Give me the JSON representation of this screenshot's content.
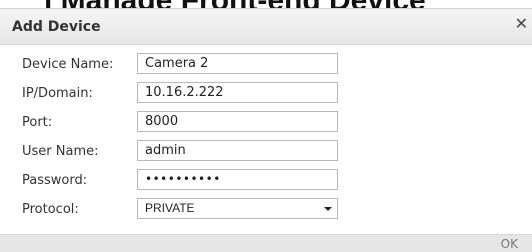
{
  "page": {
    "heading": "i Manage Front-end Device"
  },
  "dialog": {
    "title": "Add Device",
    "close_icon": "close-icon",
    "fields": [
      {
        "label": "Device Name:",
        "value": "Camera 2",
        "type": "text"
      },
      {
        "label": "IP/Domain:",
        "value": "10.16.2.222",
        "type": "text"
      },
      {
        "label": "Port:",
        "value": "8000",
        "type": "text"
      },
      {
        "label": "User Name:",
        "value": "admin",
        "type": "text"
      },
      {
        "label": "Password:",
        "value": "••••••••••",
        "type": "password"
      },
      {
        "label": "Protocol:",
        "value": "PRIVATE",
        "type": "select"
      }
    ],
    "ok_label": "OK"
  }
}
